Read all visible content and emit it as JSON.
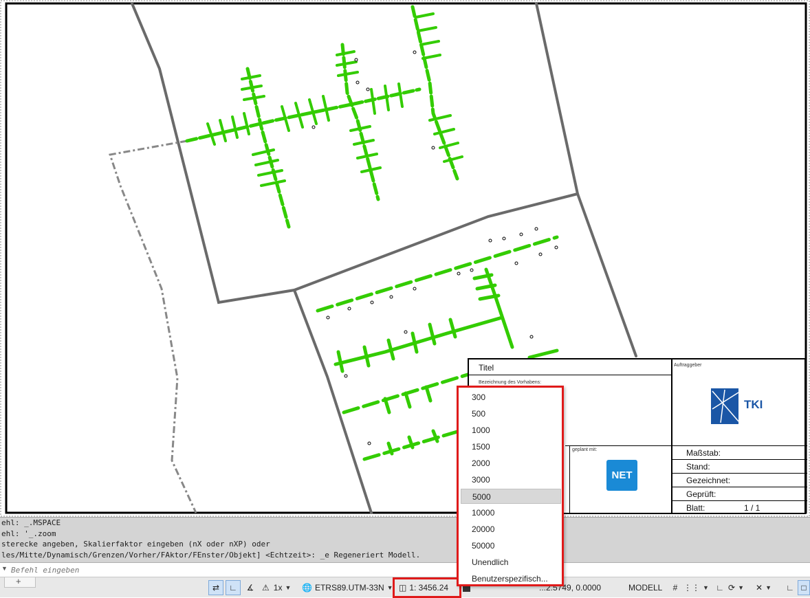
{
  "title_block": {
    "titel_label": "Titel",
    "vorhaben_label": "Bezeichnung des Vorhabens:",
    "auftraggeber_label": "Auftraggeber",
    "client_logo_text": "TKI",
    "geplant_label": "geplant mit:",
    "net_logo_text": "NET",
    "massstab_label": "Maßstab:",
    "stand_label": "Stand:",
    "gezeichnet_label": "Gezeichnet:",
    "geprueft_label": "Geprüft:",
    "blatt_label": "Blatt:",
    "blatt_value": "1 / 1"
  },
  "command_line": {
    "history": [
      "ehl: _.MSPACE",
      "ehl: '_.zoom",
      "sterecke angeben, Skalierfaktor eingeben (nX oder nXP) oder",
      "les/Mitte/Dynamisch/Grenzen/Vorher/FAktor/FEnster/Objekt] <Echtzeit>: _e Regeneriert Modell."
    ],
    "placeholder": "Befehl eingeben"
  },
  "scale_dropdown": {
    "options": [
      "300",
      "500",
      "1000",
      "1500",
      "2000",
      "3000",
      "5000",
      "10000",
      "20000",
      "50000",
      "Unendlich",
      "Benutzerspezifisch..."
    ],
    "selected": "5000"
  },
  "status_bar": {
    "plus": "+",
    "annotation_scale": "1x",
    "coordinate_system": "ETRS89.UTM-33N",
    "scale": "1: 3456.24",
    "coordinates": "...2.5749, 0.0000",
    "space": "MODELL"
  },
  "colors": {
    "highlight": "#e01a1a",
    "line_green": "#33cc00",
    "boundary": "#6a6a6a"
  }
}
